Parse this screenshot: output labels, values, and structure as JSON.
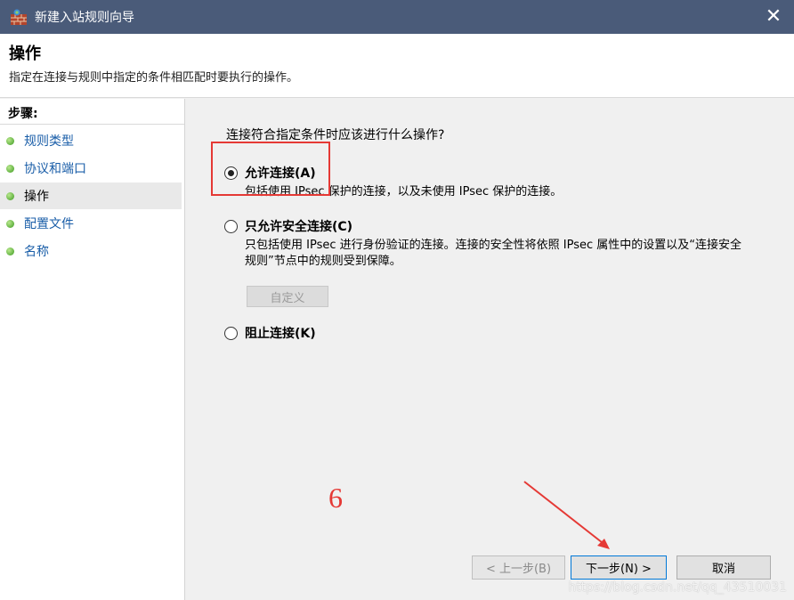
{
  "window": {
    "title": "新建入站规则向导",
    "close_glyph": "✕"
  },
  "header": {
    "title": "操作",
    "description": "指定在连接与规则中指定的条件相匹配时要执行的操作。"
  },
  "sidebar": {
    "steps_label": "步骤:",
    "items": [
      {
        "label": "规则类型"
      },
      {
        "label": "协议和端口"
      },
      {
        "label": "操作"
      },
      {
        "label": "配置文件"
      },
      {
        "label": "名称"
      }
    ]
  },
  "main": {
    "question": "连接符合指定条件时应该进行什么操作?",
    "options": [
      {
        "label": "允许连接(A)",
        "description": "包括使用 IPsec 保护的连接，以及未使用 IPsec 保护的连接。",
        "checked": true
      },
      {
        "label": "只允许安全连接(C)",
        "description": "只包括使用 IPsec 进行身份验证的连接。连接的安全性将依照 IPsec 属性中的设置以及“连接安全规则”节点中的规则受到保障。",
        "checked": false
      },
      {
        "label": "阻止连接(K)",
        "description": "",
        "checked": false
      }
    ],
    "custom_button": "自定义"
  },
  "annotation": {
    "number": "6"
  },
  "footer": {
    "back": "< 上一步(B)",
    "next": "下一步(N) >",
    "cancel": "取消"
  },
  "watermark": "https://blog.csdn.net/qq_43510031",
  "colors": {
    "titlebar": "#4a5b79",
    "step_link": "#1a5ea8",
    "annotation": "#e53935"
  }
}
